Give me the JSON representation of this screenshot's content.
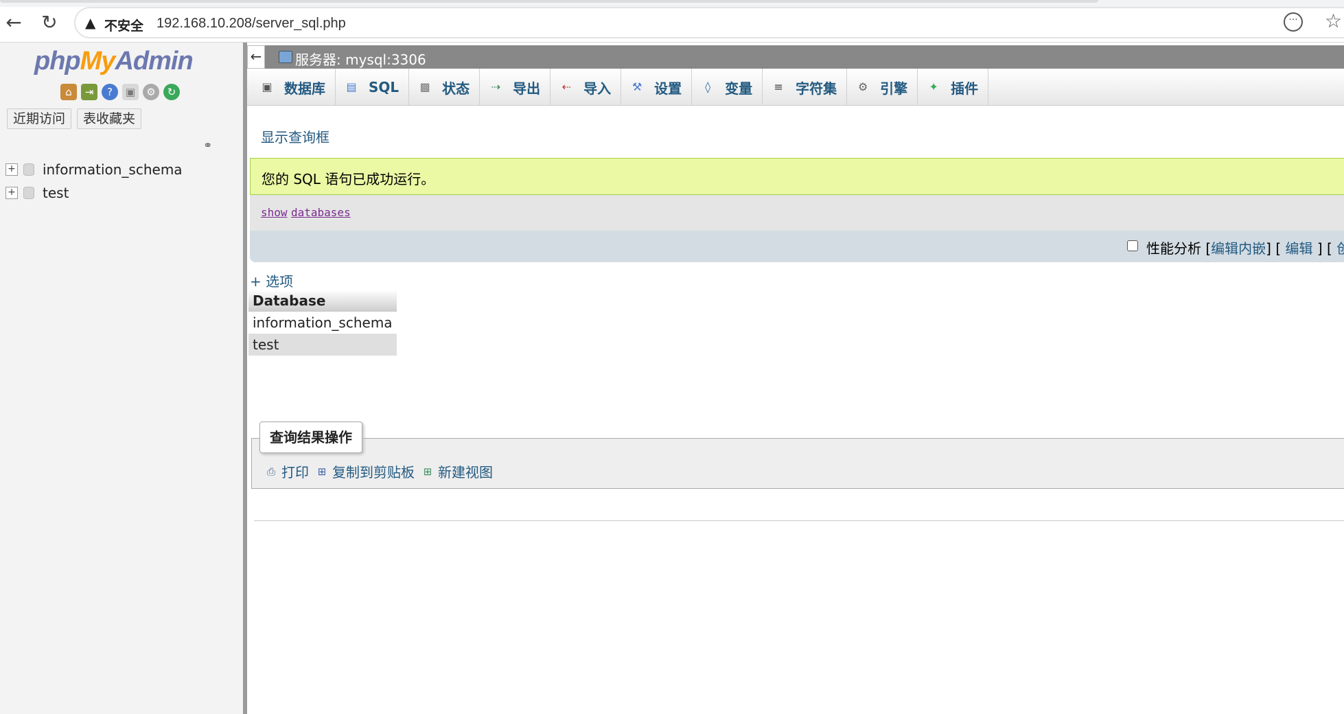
{
  "browser": {
    "insecure_label": "不安全",
    "url": "192.168.10.208/server_sql.php"
  },
  "nav": {
    "logo_php": "php",
    "logo_my": "My",
    "logo_admin": "Admin",
    "tabs": [
      "近期访问",
      "表收藏夹"
    ],
    "databases": [
      "information_schema",
      "test"
    ]
  },
  "server_bar": {
    "label": "服务器: mysql:3306"
  },
  "menu": [
    {
      "label": "数据库",
      "icon": "database-icon"
    },
    {
      "label": "SQL",
      "icon": "sql-icon"
    },
    {
      "label": "状态",
      "icon": "status-icon"
    },
    {
      "label": "导出",
      "icon": "export-icon"
    },
    {
      "label": "导入",
      "icon": "import-icon"
    },
    {
      "label": "设置",
      "icon": "wrench-icon"
    },
    {
      "label": "变量",
      "icon": "variables-icon"
    },
    {
      "label": "字符集",
      "icon": "charset-icon"
    },
    {
      "label": "引擎",
      "icon": "engine-icon"
    },
    {
      "label": "插件",
      "icon": "plugin-icon"
    }
  ],
  "main": {
    "show_query_box": "显示查询框",
    "success_message": "您的 SQL 语句已成功运行。",
    "sql_keyword_show": "show",
    "sql_keyword_databases": "databases",
    "profiling": {
      "label": "性能分析",
      "edit_inline": "编辑内嵌",
      "edit": "编辑",
      "create_prefix": "创建"
    },
    "options_link": "+ 选项",
    "results": {
      "header": "Database",
      "rows": [
        "information_schema",
        "test"
      ]
    },
    "operations": {
      "legend": "查询结果操作",
      "print": "打印",
      "copy_clipboard": "复制到剪贴板",
      "new_view": "新建视图"
    }
  }
}
